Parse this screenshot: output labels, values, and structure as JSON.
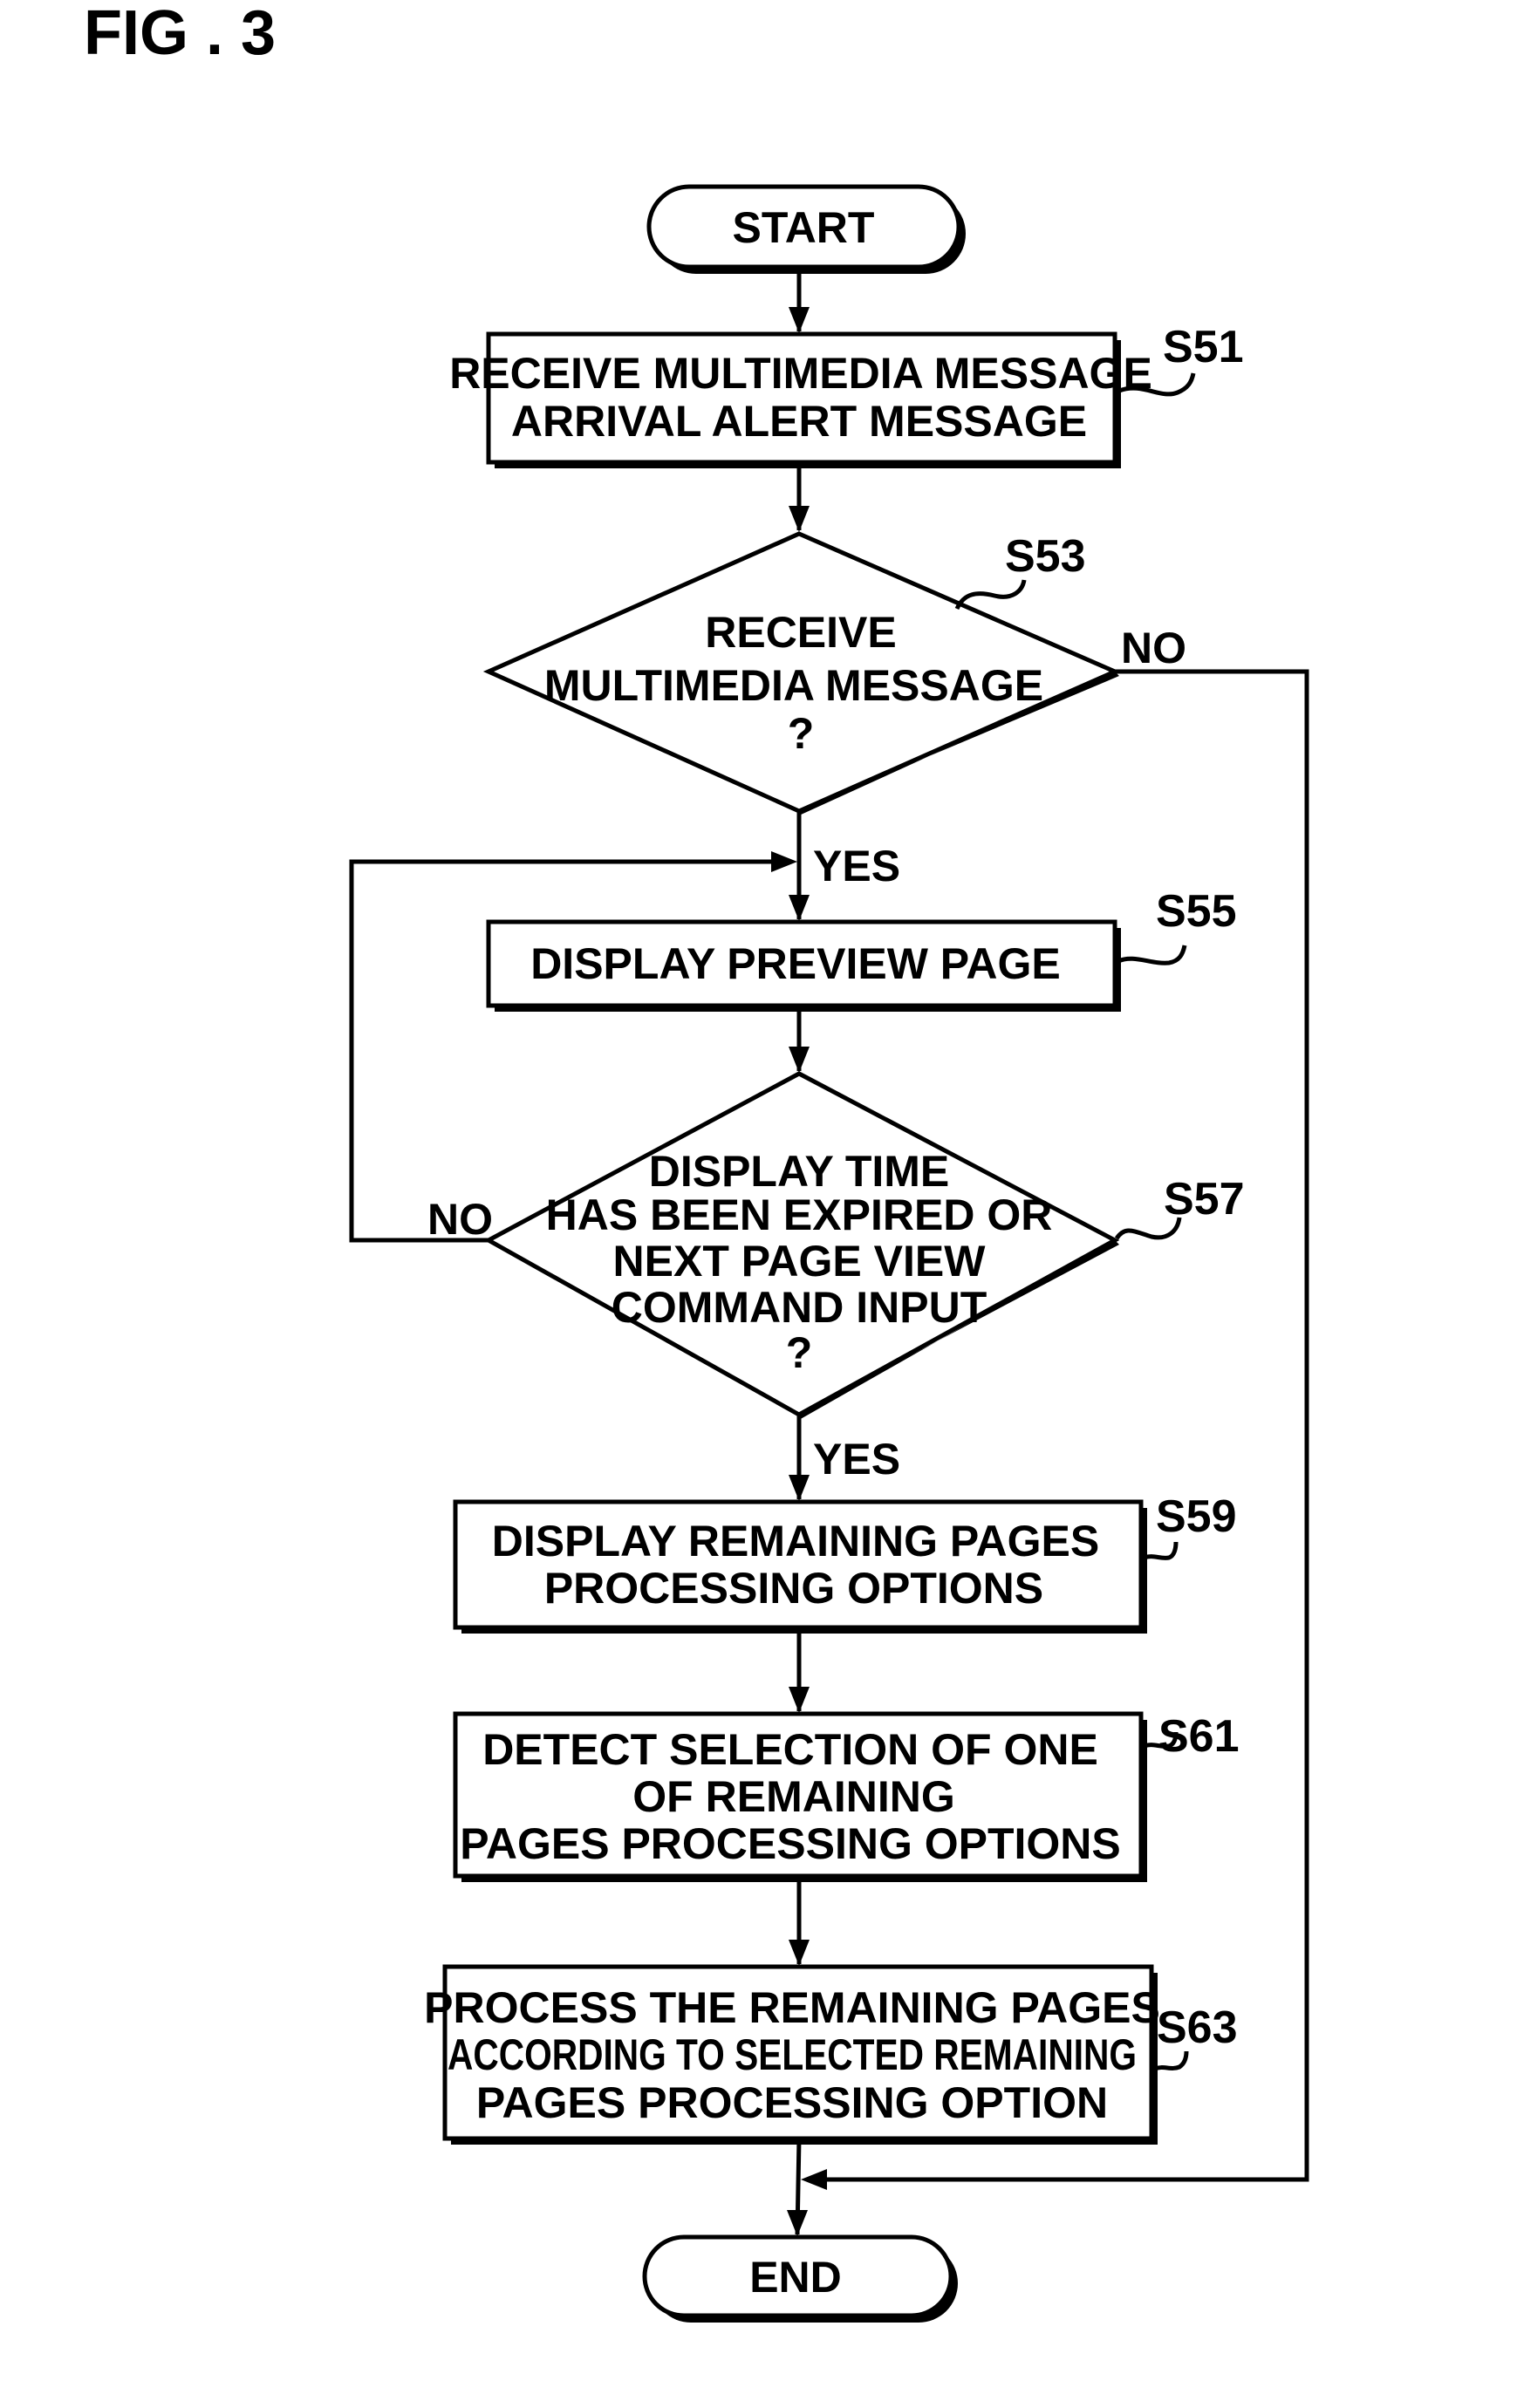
{
  "figure": {
    "title": "FIG . 3"
  },
  "nodes": {
    "start": {
      "type": "terminal",
      "label": "START"
    },
    "s51": {
      "type": "process",
      "id": "S51",
      "lines": [
        "RECEIVE MULTIMEDIA MESSAGE",
        "ARRIVAL ALERT MESSAGE"
      ]
    },
    "s53": {
      "type": "decision",
      "id": "S53",
      "lines": [
        "RECEIVE",
        "MULTIMEDIA MESSAGE",
        "?"
      ]
    },
    "s55": {
      "type": "process",
      "id": "S55",
      "lines": [
        "DISPLAY PREVIEW PAGE"
      ]
    },
    "s57": {
      "type": "decision",
      "id": "S57",
      "lines": [
        "DISPLAY TIME",
        "HAS BEEN EXPIRED OR",
        "NEXT PAGE VIEW",
        "COMMAND INPUT",
        "?"
      ]
    },
    "s59": {
      "type": "process",
      "id": "S59",
      "lines": [
        "DISPLAY REMAINING PAGES",
        "PROCESSING OPTIONS"
      ]
    },
    "s61": {
      "type": "process",
      "id": "S61",
      "lines": [
        "DETECT SELECTION OF ONE",
        "OF REMAINING",
        "PAGES PROCESSING OPTIONS"
      ]
    },
    "s63": {
      "type": "process",
      "id": "S63",
      "lines": [
        "PROCESS THE REMAINING PAGES",
        "ACCORDING TO SELECTED REMAINING",
        "PAGES PROCESSING OPTION"
      ]
    },
    "end": {
      "type": "terminal",
      "label": "END"
    }
  },
  "edges": [
    {
      "from": "start",
      "to": "s51",
      "label": ""
    },
    {
      "from": "s51",
      "to": "s53",
      "label": ""
    },
    {
      "from": "s53",
      "to": "s55",
      "label": "YES"
    },
    {
      "from": "s53",
      "to": "end",
      "label": "NO"
    },
    {
      "from": "s55",
      "to": "s57",
      "label": ""
    },
    {
      "from": "s57",
      "to": "s55",
      "label": "NO"
    },
    {
      "from": "s57",
      "to": "s59",
      "label": "YES"
    },
    {
      "from": "s59",
      "to": "s61",
      "label": ""
    },
    {
      "from": "s61",
      "to": "s63",
      "label": ""
    },
    {
      "from": "s63",
      "to": "end",
      "label": ""
    }
  ],
  "edge_labels": {
    "s53_yes": "YES",
    "s53_no": "NO",
    "s57_yes": "YES",
    "s57_no": "NO"
  }
}
